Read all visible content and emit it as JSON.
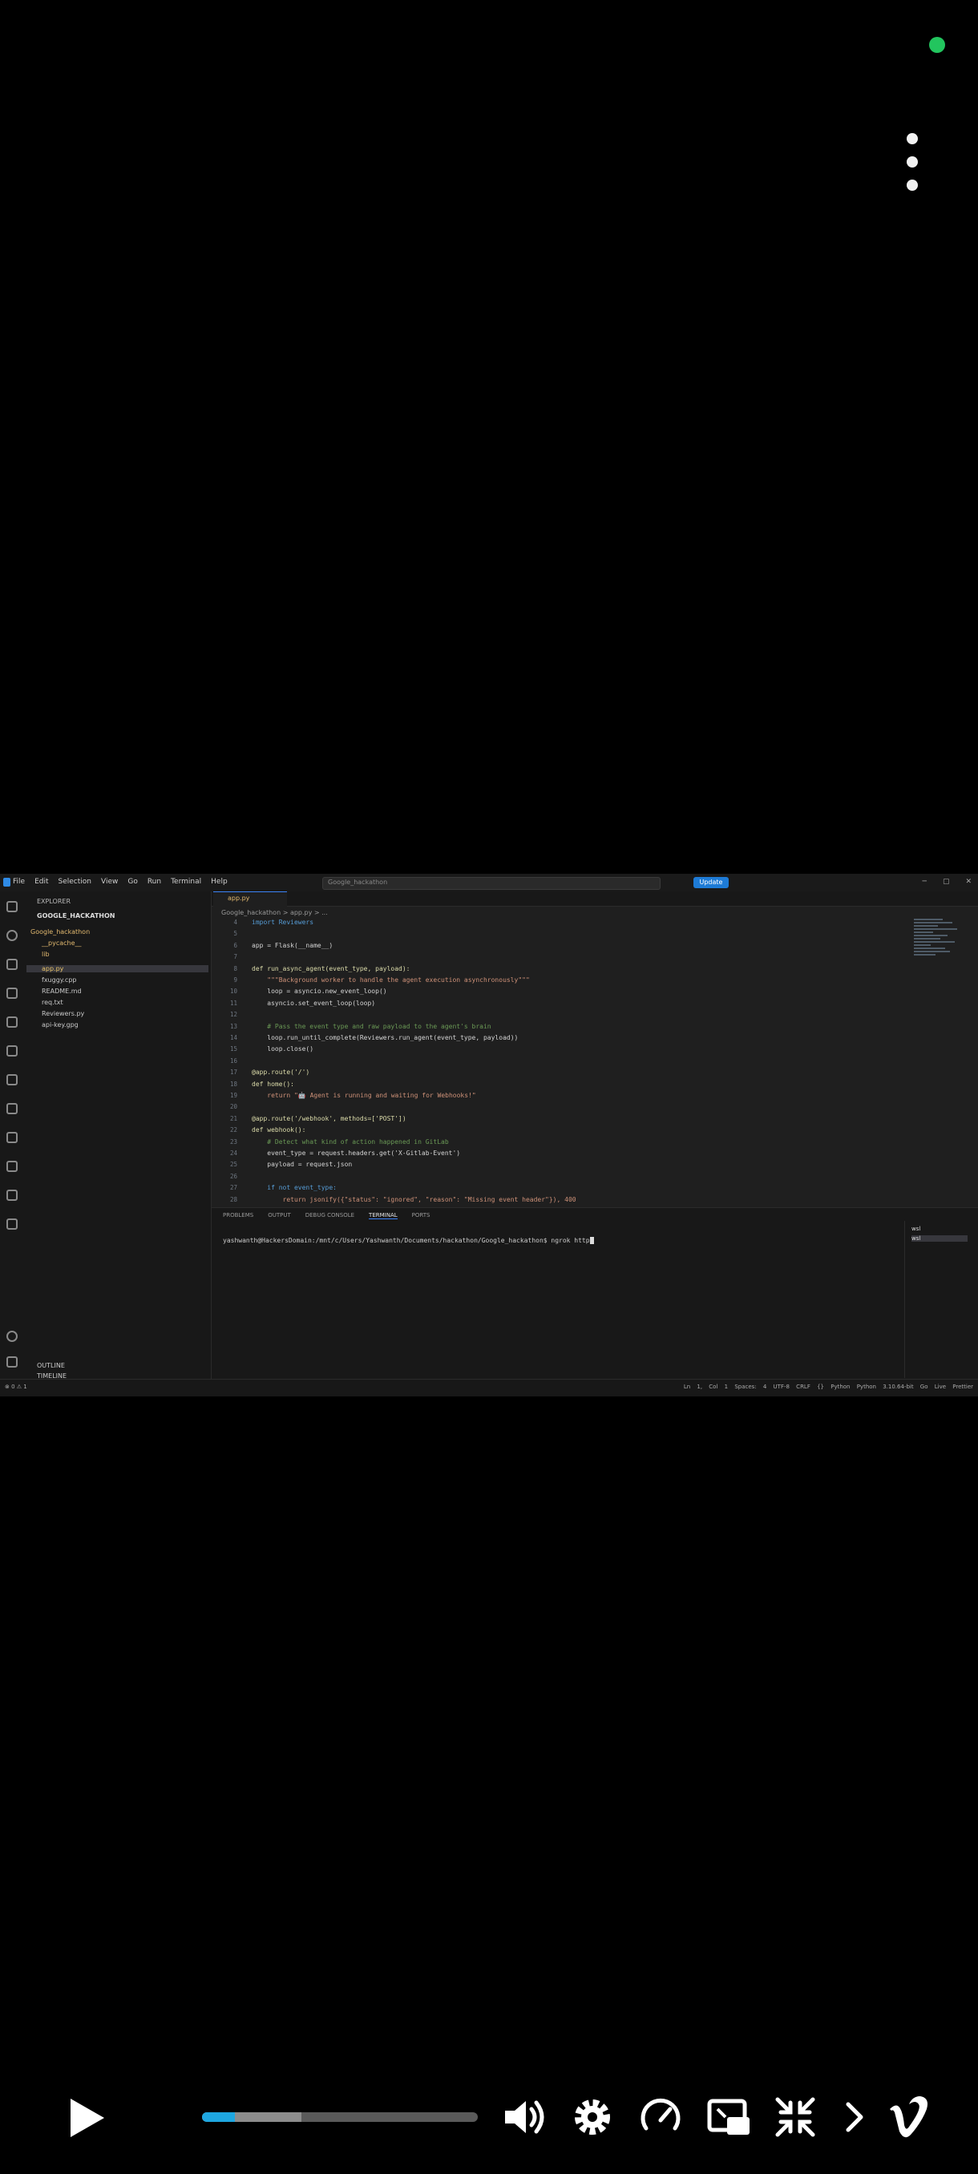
{
  "colors": {
    "accent": "#1ea7e1",
    "online": "#22c55e",
    "code_keyword": "#569cd6",
    "code_string": "#ce9178",
    "code_func": "#dcdcaa",
    "code_comment": "#6a9955"
  },
  "player": {
    "progress_fraction": 0.12,
    "buffered_fraction": 0.36,
    "icons": [
      "more-vertical-icon",
      "play-icon",
      "volume-icon",
      "settings-gear-icon",
      "speed-gauge-icon",
      "picture-in-picture-icon",
      "exit-fullscreen-icon",
      "chevron-right-icon",
      "vimeo-logo-icon"
    ]
  },
  "vscode": {
    "menu": [
      "File",
      "Edit",
      "Selection",
      "View",
      "Go",
      "Run",
      "Terminal",
      "Help"
    ],
    "search": "Google_hackathon",
    "update_label": "Update",
    "explorer": {
      "header": "EXPLORER",
      "project": "GOOGLE_HACKATHON",
      "files": [
        {
          "name": "Google_hackathon",
          "type": "dir"
        },
        {
          "name": "__pycache__",
          "type": "dir"
        },
        {
          "name": "lib",
          "type": "dir"
        },
        {
          "name": "app.py",
          "type": "sel"
        },
        {
          "name": "fxuggy.cpp",
          "type": "file"
        },
        {
          "name": "README.md",
          "type": "file"
        },
        {
          "name": "req.txt",
          "type": "file"
        },
        {
          "name": "Reviewers.py",
          "type": "file"
        },
        {
          "name": "api-key.gpg",
          "type": "file"
        }
      ],
      "outline": "OUTLINE",
      "timeline": "TIMELINE"
    },
    "tab_label": "app.py",
    "breadcrumb": "Google_hackathon > app.py > ...",
    "code_lines": [
      {
        "n": "4",
        "t": "import Reviewers",
        "c": "kw"
      },
      {
        "n": "5",
        "t": "",
        "c": "plain"
      },
      {
        "n": "6",
        "t": "app = Flask(__name__)",
        "c": "plain"
      },
      {
        "n": "7",
        "t": "",
        "c": "plain"
      },
      {
        "n": "8",
        "t": "def run_async_agent(event_type, payload):",
        "c": "func"
      },
      {
        "n": "9",
        "t": "    \"\"\"Background worker to handle the agent execution asynchronously\"\"\"",
        "c": "str"
      },
      {
        "n": "10",
        "t": "    loop = asyncio.new_event_loop()",
        "c": "plain"
      },
      {
        "n": "11",
        "t": "    asyncio.set_event_loop(loop)",
        "c": "plain"
      },
      {
        "n": "12",
        "t": "",
        "c": "plain"
      },
      {
        "n": "13",
        "t": "    # Pass the event type and raw payload to the agent's brain",
        "c": "cmt"
      },
      {
        "n": "14",
        "t": "    loop.run_until_complete(Reviewers.run_agent(event_type, payload))",
        "c": "plain"
      },
      {
        "n": "15",
        "t": "    loop.close()",
        "c": "plain"
      },
      {
        "n": "16",
        "t": "",
        "c": "plain"
      },
      {
        "n": "17",
        "t": "@app.route('/')",
        "c": "func"
      },
      {
        "n": "18",
        "t": "def home():",
        "c": "func"
      },
      {
        "n": "19",
        "t": "    return \"🤖 Agent is running and waiting for Webhooks!\"",
        "c": "str"
      },
      {
        "n": "20",
        "t": "",
        "c": "plain"
      },
      {
        "n": "21",
        "t": "@app.route('/webhook', methods=['POST'])",
        "c": "func"
      },
      {
        "n": "22",
        "t": "def webhook():",
        "c": "func"
      },
      {
        "n": "23",
        "t": "    # Detect what kind of action happened in GitLab",
        "c": "cmt"
      },
      {
        "n": "24",
        "t": "    event_type = request.headers.get('X-Gitlab-Event')",
        "c": "plain"
      },
      {
        "n": "25",
        "t": "    payload = request.json",
        "c": "plain"
      },
      {
        "n": "26",
        "t": "",
        "c": "plain"
      },
      {
        "n": "27",
        "t": "    if not event_type:",
        "c": "kw"
      },
      {
        "n": "28",
        "t": "        return jsonify({\"status\": \"ignored\", \"reason\": \"Missing event header\"}), 400",
        "c": "str"
      }
    ],
    "panel_tabs": [
      "PROBLEMS",
      "OUTPUT",
      "DEBUG CONSOLE",
      "TERMINAL",
      "PORTS"
    ],
    "terminal_prompt": "yashwanth@HackersDomain:/mnt/c/Users/Yashwanth/Documents/hackathon/Google_hackathon$ ngrok http",
    "terminal_sessions": [
      "wsl",
      "wsl"
    ],
    "status_left": "⊗ 0 ⚠ 1",
    "status_right": "Ln 1, Col 1  Spaces: 4  UTF-8  CRLF  {} Python  Python 3.10.64-bit  Go Live  Prettier"
  }
}
